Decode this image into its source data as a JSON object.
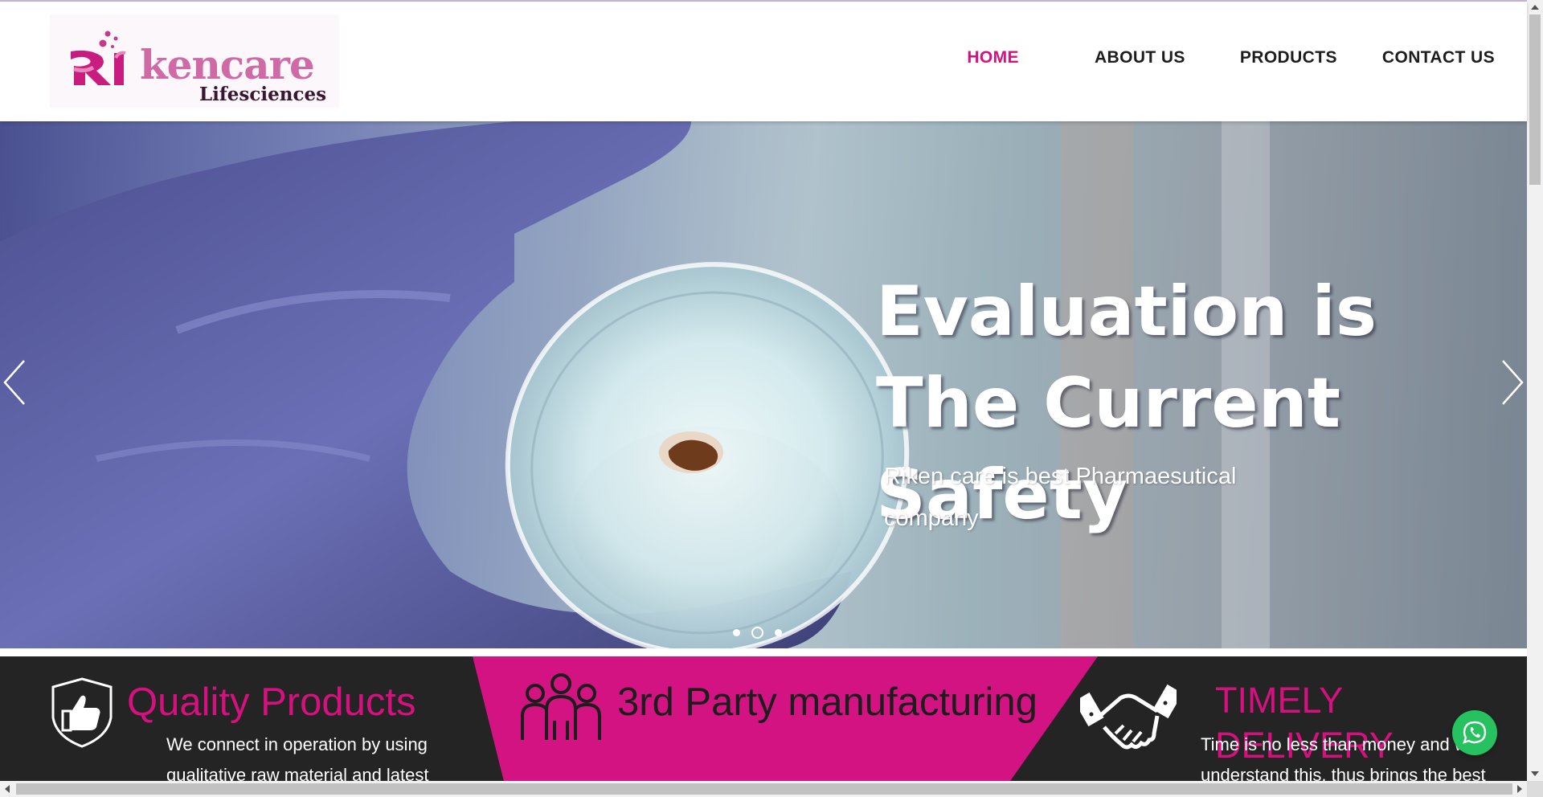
{
  "header": {
    "logo": {
      "brand": "kencare",
      "subtitle": "Lifesciences"
    },
    "nav": [
      {
        "label": "HOME",
        "active": true
      },
      {
        "label": "ABOUT US",
        "active": false
      },
      {
        "label": "PRODUCTS",
        "active": false
      },
      {
        "label": "CONTACT US",
        "active": false
      }
    ]
  },
  "hero": {
    "title": "Evaluation is  The Current Safety",
    "subtitle": "Riken care is best Pharmaesutical company",
    "slides_total": 3,
    "active_slide": 2
  },
  "features": [
    {
      "title": "Quality Products",
      "text": "We connect in operation by using qualitative raw material and latest",
      "icon": "thumbs-up-shield-icon"
    },
    {
      "title": "3rd Party manufacturing",
      "text": "",
      "icon": "team-icon"
    },
    {
      "title": "TIMELY DELIVERY",
      "text": "Time is no less than money and we understand this, thus brings the best",
      "icon": "handshake-icon"
    }
  ],
  "colors": {
    "accent": "#d6107e",
    "dark": "#242424",
    "whatsapp": "#25c25f"
  }
}
